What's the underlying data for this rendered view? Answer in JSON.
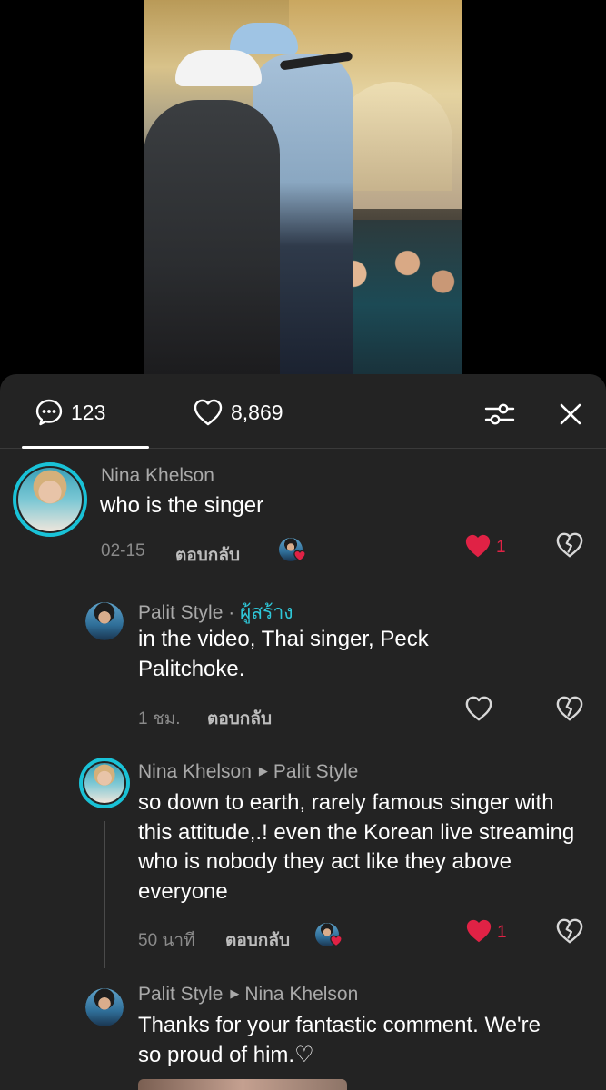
{
  "tabs": {
    "comments_count": "123",
    "likes_count": "8,869"
  },
  "comments": [
    {
      "author": "Nina Khelson",
      "text": "who is the singer",
      "time": "02-15",
      "reply_label": "ตอบกลับ",
      "likes": "1"
    }
  ],
  "replies": [
    {
      "author": "Palit Style",
      "creator_tag": "ผู้สร้าง",
      "text": "in the video, Thai singer, Peck Palitchoke.",
      "time": "1 ชม.",
      "reply_label": "ตอบกลับ"
    },
    {
      "author": "Nina Khelson",
      "reply_to": "Palit Style",
      "text": "so down to earth, rarely famous singer with this attitude,.! even the Korean live streaming who is nobody they act like they above everyone",
      "time": "50 นาที",
      "reply_label": "ตอบกลับ",
      "likes": "1"
    },
    {
      "author": "Palit Style",
      "reply_to": "Nina Khelson",
      "text": "Thanks for your fantastic comment. We're so proud of him.♡"
    }
  ],
  "colors": {
    "panel_bg": "#232323",
    "accent_teal": "#19c2d7",
    "heart_red": "#e02245",
    "meta_gray": "#8a8a8a"
  }
}
